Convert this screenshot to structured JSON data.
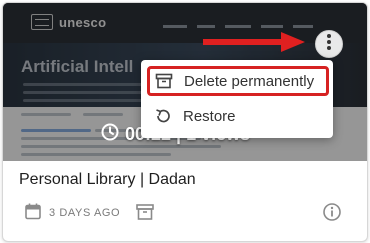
{
  "preview": {
    "logo_text": "unesco",
    "hero_title": "Artificial Intell"
  },
  "stats": {
    "text": "00:22 | 1 views"
  },
  "menu": {
    "items": [
      {
        "label": "Delete permanently",
        "icon": "archive-box-icon",
        "highlighted": true
      },
      {
        "label": "Restore",
        "icon": "restore-icon",
        "highlighted": false
      }
    ]
  },
  "card": {
    "title": "Personal Library | Dadan",
    "date": "3 DAYS AGO",
    "meta_icons": [
      "calendar-icon",
      "archive-icon",
      "info-icon"
    ]
  },
  "colors": {
    "highlight_border": "#d62222",
    "arrow": "#e02020"
  }
}
